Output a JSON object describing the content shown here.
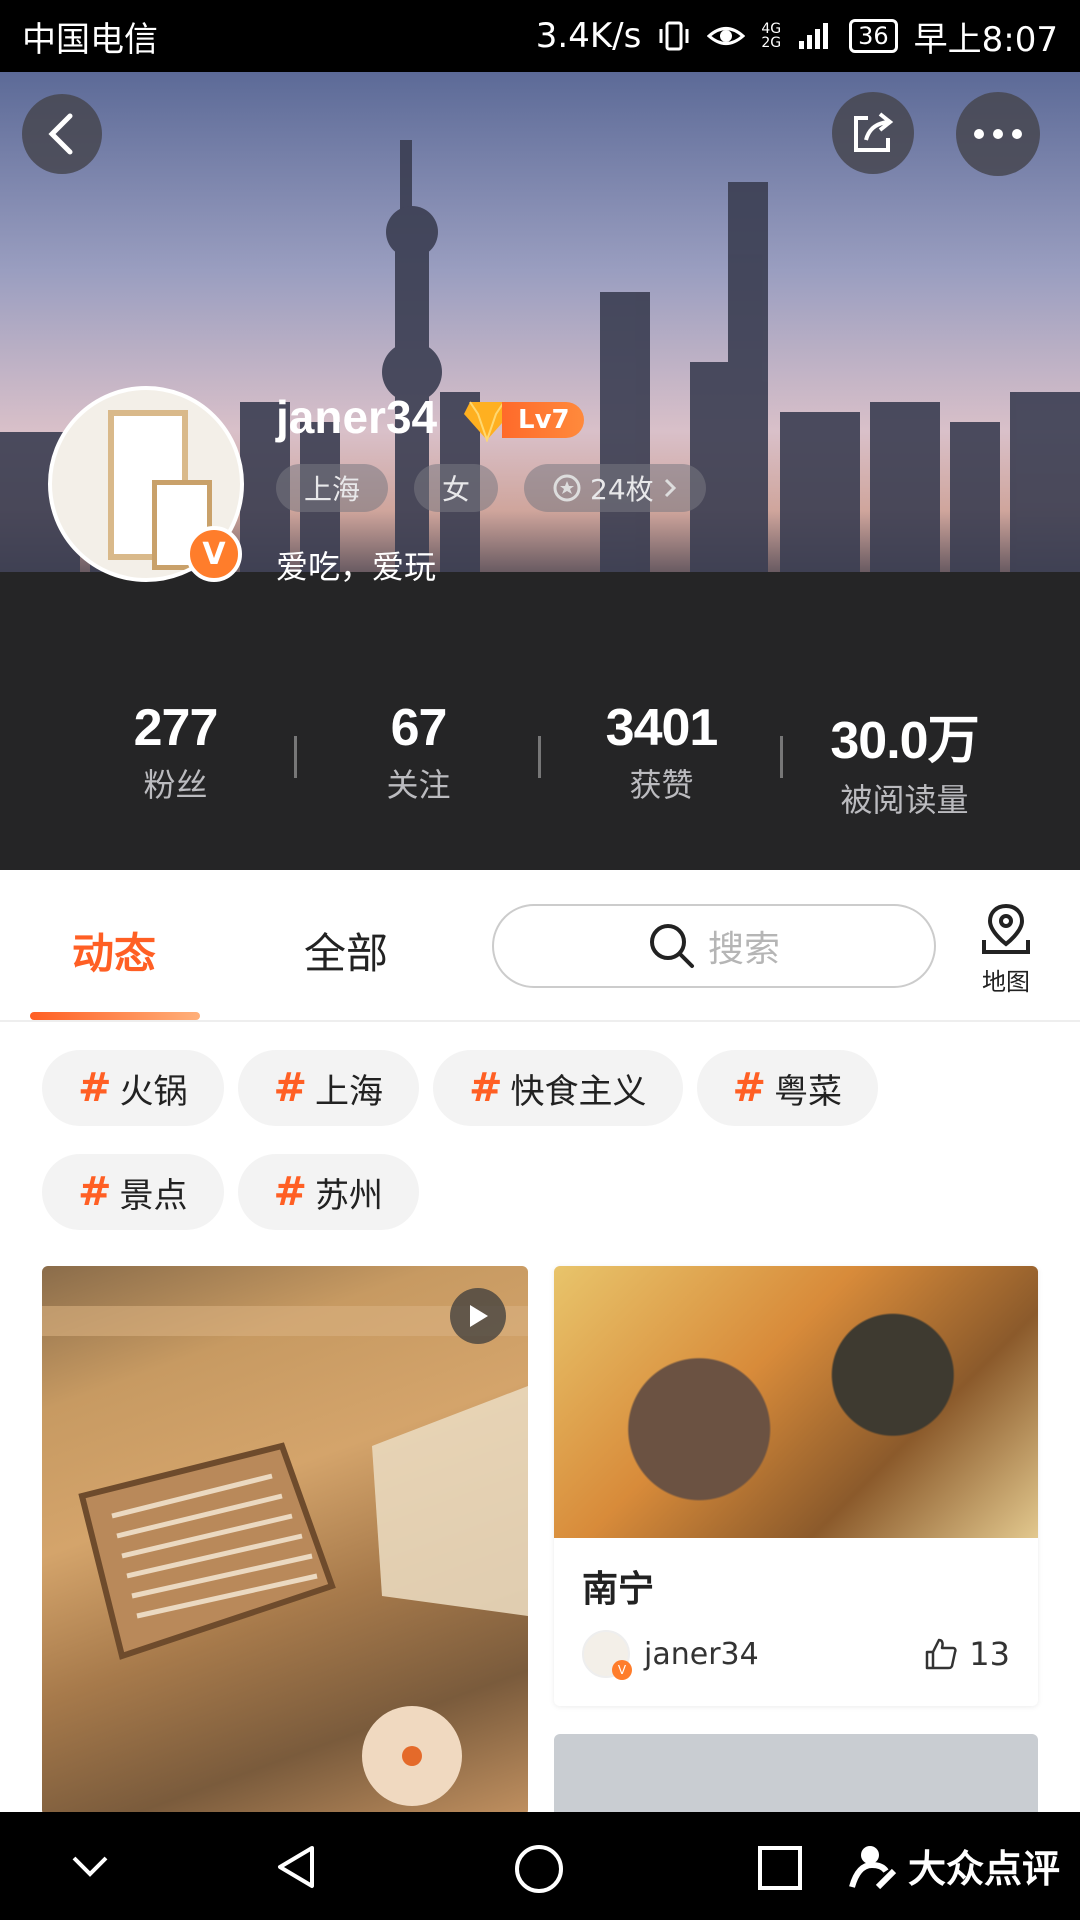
{
  "status_bar": {
    "carrier": "中国电信",
    "speed": "3.4K/s",
    "network_top": "4G",
    "network_bottom": "2G",
    "battery": "36",
    "time": "早上8:07"
  },
  "profile": {
    "username": "janer34",
    "level": "Lv7",
    "city": "上海",
    "gender": "女",
    "medals": "24枚",
    "bio": "爱吃，爱玩",
    "verified_badge": "V"
  },
  "stats": [
    {
      "value": "277",
      "label": "粉丝"
    },
    {
      "value": "67",
      "label": "关注"
    },
    {
      "value": "3401",
      "label": "获赞"
    },
    {
      "value": "30.0万",
      "label": "被阅读量"
    }
  ],
  "tabs": {
    "active": "动态",
    "all": "全部",
    "search_placeholder": "搜索",
    "map_label": "地图"
  },
  "topics": [
    "火锅",
    "上海",
    "快食主义",
    "粤菜",
    "景点",
    "苏州"
  ],
  "topic_hash": "#",
  "cards": {
    "right_title": "南宁",
    "right_author": "janer34",
    "right_likes": "13"
  },
  "watermark": "大众点评",
  "colors": {
    "accent": "#ff5f24",
    "badge": "#ff7d2b",
    "header_dark": "#252526"
  }
}
